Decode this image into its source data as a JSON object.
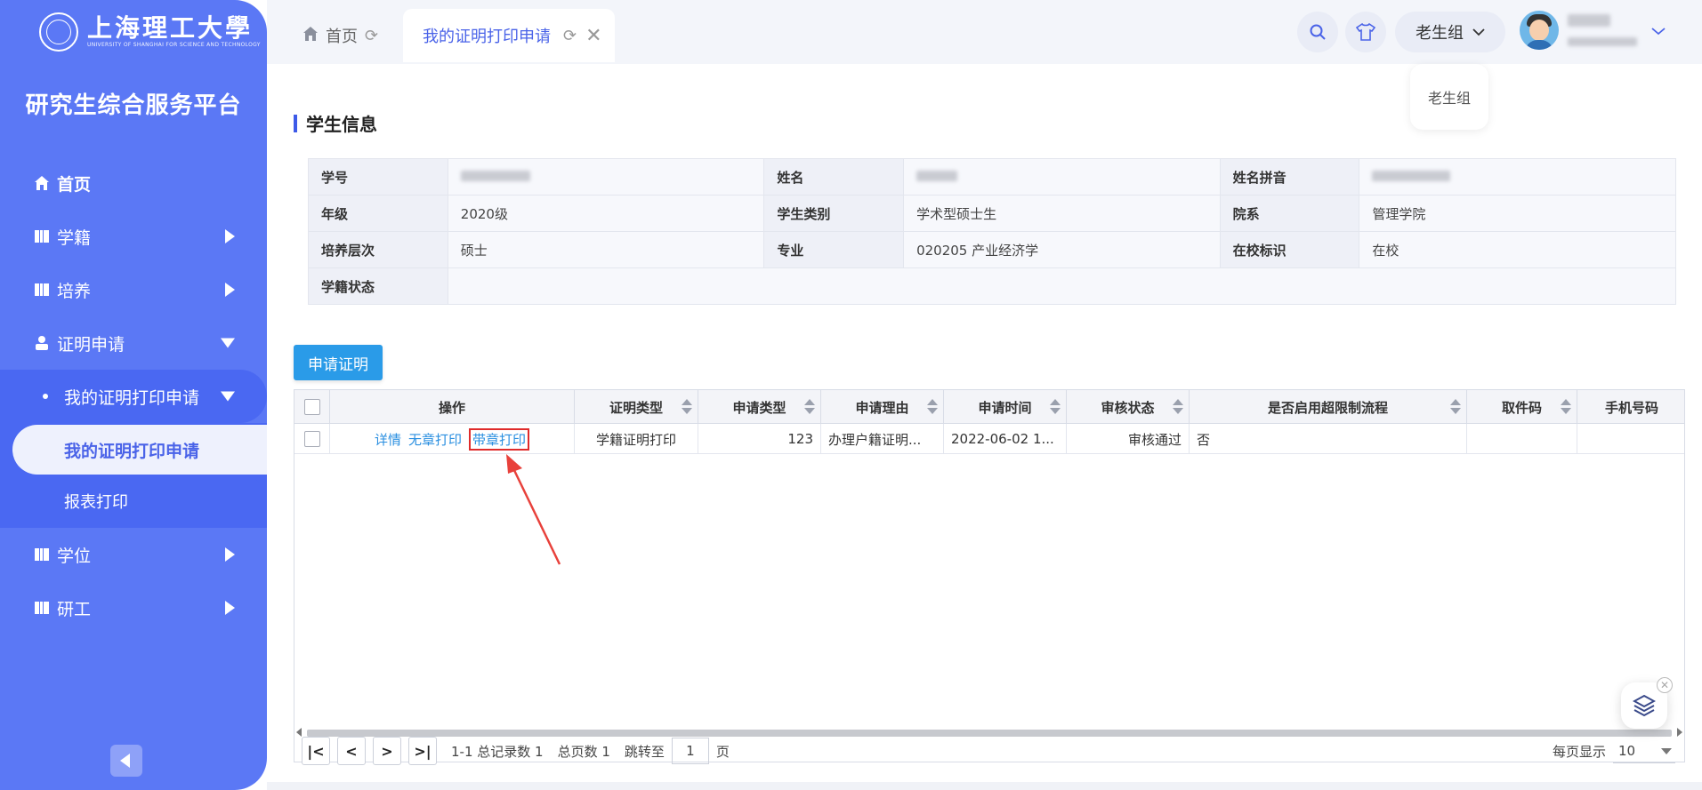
{
  "sidebar": {
    "logo_cn": "上海理工大學",
    "logo_en": "UNIVERSITY OF SHANGHAI FOR SCIENCE AND TECHNOLOGY",
    "platform_title": "研究生综合服务平台",
    "items": [
      {
        "label": "首页",
        "icon": "home-icon"
      },
      {
        "label": "学籍",
        "icon": "book-icon"
      },
      {
        "label": "培养",
        "icon": "book-icon"
      },
      {
        "label": "证明申请",
        "icon": "user-cert-icon"
      },
      {
        "label": "学位",
        "icon": "book-icon"
      },
      {
        "label": "研工",
        "icon": "book-icon"
      }
    ],
    "sub_open": "我的证明打印申请",
    "sub_active": "我的证明打印申请",
    "sub_plain": "报表打印"
  },
  "topbar": {
    "tab_home": "首页",
    "tab_active": "我的证明打印申请",
    "role": "老生组",
    "role_popup": "老生组"
  },
  "content": {
    "section_title": "学生信息",
    "info": {
      "rows": [
        [
          {
            "k": "学号",
            "v": ""
          },
          {
            "k": "姓名",
            "v": ""
          },
          {
            "k": "姓名拼音",
            "v": ""
          }
        ],
        [
          {
            "k": "年级",
            "v": "2020级"
          },
          {
            "k": "学生类别",
            "v": "学术型硕士生"
          },
          {
            "k": "院系",
            "v": "管理学院"
          }
        ],
        [
          {
            "k": "培养层次",
            "v": "硕士"
          },
          {
            "k": "专业",
            "v": "020205 产业经济学"
          },
          {
            "k": "在校标识",
            "v": "在校"
          }
        ]
      ],
      "last_row_key": "学籍状态",
      "last_row_value": ""
    },
    "apply_button": "申请证明",
    "grid": {
      "headers": [
        "操作",
        "证明类型",
        "申请类型",
        "申请理由",
        "申请时间",
        "审核状态",
        "是否启用超限制流程",
        "取件码",
        "手机号码"
      ],
      "row": {
        "ops": [
          "详情",
          "无章打印",
          "带章打印"
        ],
        "cert_type": "学籍证明打印",
        "apply_type": "123",
        "reason": "办理户籍证明...",
        "time": "2022-06-02 1...",
        "status": "审核通过",
        "over_limit": "否",
        "pickup_code": "",
        "phone": ""
      }
    },
    "pager": {
      "summary": "1-1 总记录数 1",
      "total_pages": "总页数 1",
      "jump_label": "跳转至",
      "jump_value": "1",
      "page_unit": "页",
      "per_page_label": "每页显示",
      "per_page_value": "10"
    }
  },
  "colors": {
    "sidebar": "#5b78f5",
    "accent": "#4a63e8",
    "button": "#2a9be8",
    "highlight_box": "#e02b2b"
  }
}
